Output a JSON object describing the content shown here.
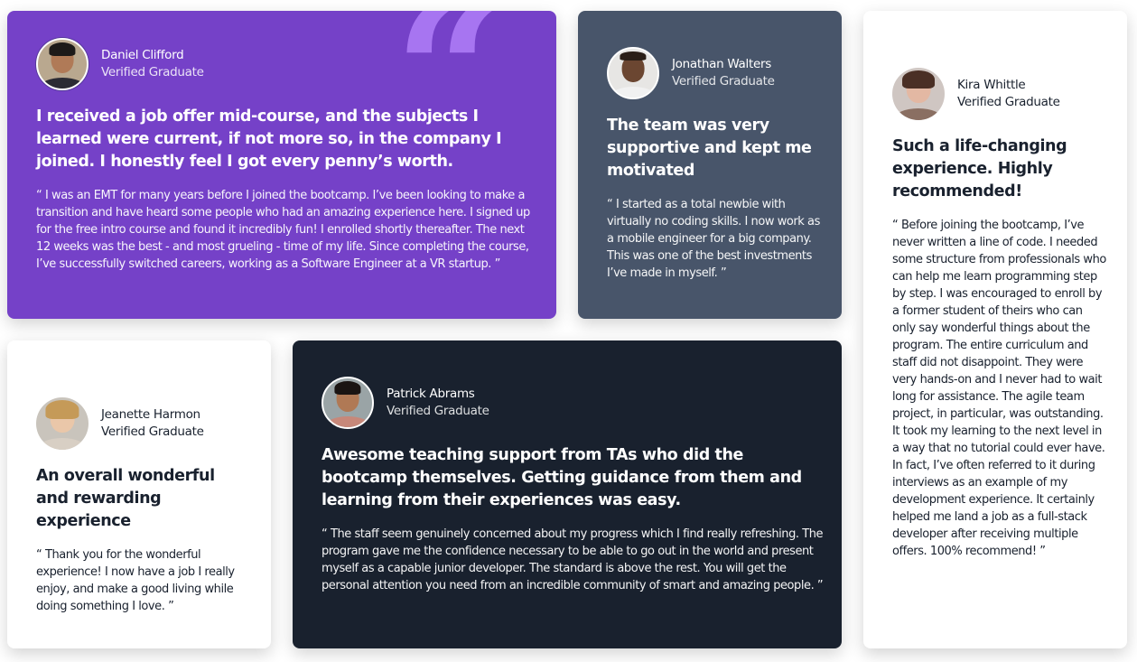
{
  "testimonials": {
    "daniel": {
      "name": "Daniel Clifford",
      "role": "Verified Graduate",
      "headline": "I received a job offer mid-course, and the subjects I learned were current, if not more so, in the company I joined. I honestly feel I got every penny’s worth.",
      "quote": "“ I was an EMT for many years before I joined the bootcamp. I’ve been looking to make a transition and have heard some people who had an amazing experience here. I signed up for the free intro course and found it incredibly fun! I enrolled shortly thereafter. The next 12 weeks was the best - and most grueling - time of my life. Since completing the course, I’ve successfully switched careers, working as a Software Engineer at a VR startup. ”",
      "background": "#7541c8"
    },
    "jonathan": {
      "name": "Jonathan Walters",
      "role": "Verified Graduate",
      "headline": "The team was very supportive and kept me motivated",
      "quote": "“ I started as a total newbie with virtually no coding skills. I now work as a mobile engineer for a big company. This was one of the best investments I’ve made in myself. ”",
      "background": "#48556a"
    },
    "kira": {
      "name": "Kira Whittle",
      "role": "Verified Graduate",
      "headline": "Such a life-changing experience. Highly recommended!",
      "quote": "“ Before joining the bootcamp, I’ve never written a line of code. I needed some structure from professionals who can help me learn programming step by step. I was encouraged to enroll by a former student of theirs who can only say wonderful things about the program. The entire curriculum and staff did not disappoint. They were very hands-on and I never had to wait long for assistance. The agile team project, in particular, was outstanding. It took my learning to the next level in a way that no tutorial could ever have. In fact, I’ve often referred to it during interviews as an example of my development experience. It certainly helped me land a job as a full-stack developer after receiving multiple offers. 100% recommend! ”",
      "background": "#ffffff"
    },
    "jeanette": {
      "name": "Jeanette Harmon",
      "role": "Verified Graduate",
      "headline": "An overall wonderful and rewarding experience",
      "quote": "“ Thank you for the wonderful experience! I now have a job I really enjoy, and make a good living while doing something I love. ”",
      "background": "#ffffff"
    },
    "patrick": {
      "name": "Patrick Abrams",
      "role": "Verified Graduate",
      "headline": "Awesome teaching support from TAs who did the bootcamp themselves. Getting guidance from them and learning from their experiences was easy.",
      "quote": "“ The staff seem genuinely concerned about my progress which I find really refreshing. The program gave me the confidence necessary to be able to go out in the world and present myself as a capable junior developer. The standard is above the rest. You will get the personal attention you need from an incredible community of smart and amazing people. ”",
      "background": "#19212e"
    }
  },
  "decor": {
    "quote_mark": "“",
    "quote_mark_color": "#a775f1"
  }
}
